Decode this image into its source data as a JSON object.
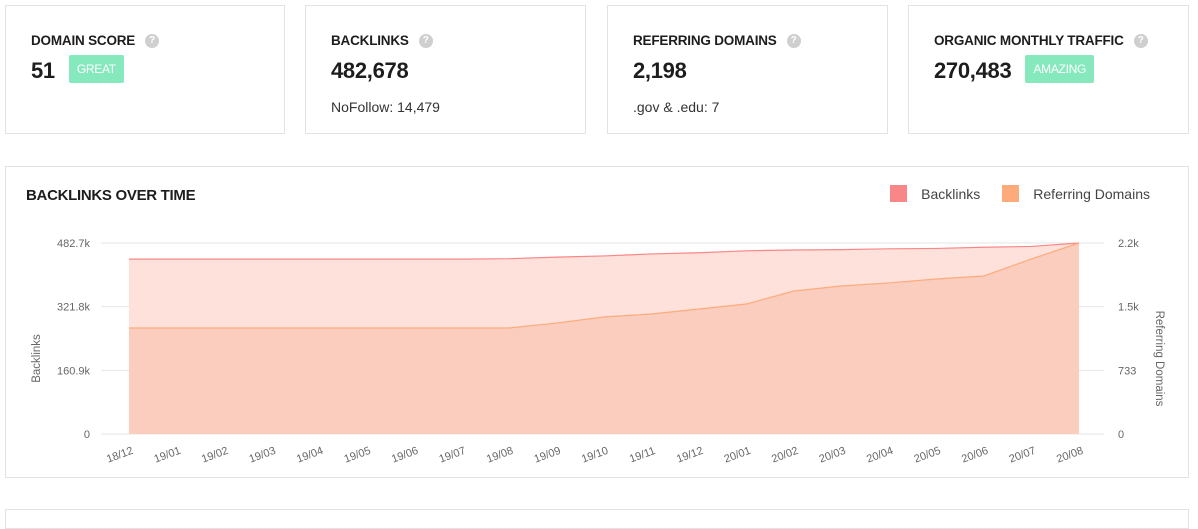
{
  "cards": [
    {
      "title": "Domain Score",
      "help_icon": "question-circle-icon",
      "value": "51",
      "badge": "GREAT",
      "sub": null
    },
    {
      "title": "Backlinks",
      "help_icon": "question-circle-icon",
      "value": "482,678",
      "badge": null,
      "sub": "NoFollow: 14,479"
    },
    {
      "title": "Referring Domains",
      "help_icon": "question-circle-icon",
      "value": "2,198",
      "badge": null,
      "sub": ".gov & .edu: 7"
    },
    {
      "title": "Organic Monthly Traffic",
      "help_icon": "question-circle-icon",
      "value": "270,483",
      "badge": "AMAZING",
      "sub": null
    }
  ],
  "colors": {
    "badge": "#86e9bd",
    "backlinks": "#f98787",
    "referring_domains": "#fdab7b",
    "backlinks_fill": "#fde1da",
    "referring_fill": "#fac9b8"
  },
  "help_glyph": "?",
  "chart_data": {
    "type": "area",
    "title": "BACKLINKS OVER TIME",
    "legend": [
      "Backlinks",
      "Referring Domains"
    ],
    "legend_position": "top-right",
    "categories": [
      "18/12",
      "19/01",
      "19/02",
      "19/03",
      "19/04",
      "19/05",
      "19/06",
      "19/07",
      "19/08",
      "19/09",
      "19/10",
      "19/11",
      "19/12",
      "20/01",
      "20/02",
      "20/03",
      "20/04",
      "20/05",
      "20/06",
      "20/07",
      "20/08"
    ],
    "series": [
      {
        "name": "Backlinks",
        "axis": "left",
        "values": [
          442000,
          442000,
          442000,
          442000,
          442000,
          442000,
          442000,
          442000,
          443000,
          447000,
          450000,
          455000,
          458000,
          463000,
          465000,
          466000,
          468000,
          469000,
          472000,
          474000,
          482700
        ]
      },
      {
        "name": "Referring Domains",
        "axis": "right",
        "values": [
          1221,
          1221,
          1221,
          1221,
          1221,
          1221,
          1221,
          1221,
          1221,
          1278,
          1348,
          1382,
          1440,
          1497,
          1647,
          1705,
          1740,
          1785,
          1820,
          2016,
          2200
        ]
      }
    ],
    "y_left": {
      "label": "Backlinks",
      "ticks": [
        "0",
        "160.9k",
        "321.8k",
        "482.7k"
      ],
      "range": [
        0,
        482700
      ]
    },
    "y_right": {
      "label": "Referring Domains",
      "ticks": [
        "0",
        "733",
        "1.5k",
        "2.2k"
      ],
      "range": [
        0,
        2200
      ]
    },
    "grid": true
  }
}
